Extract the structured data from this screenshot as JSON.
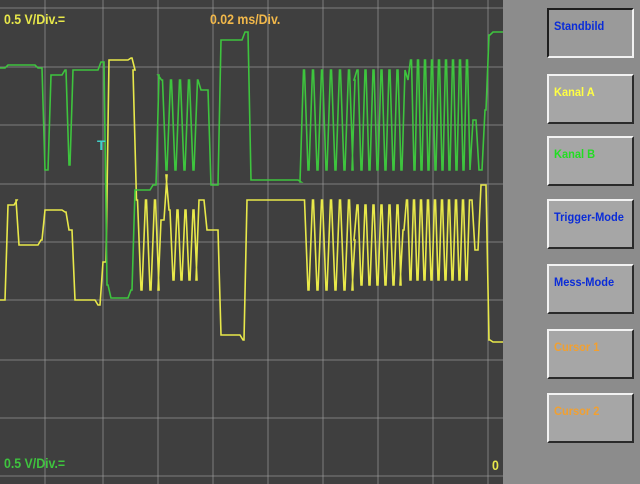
{
  "scope": {
    "ch_a_scale": "0.5 V/Div.=",
    "timebase": "0.02 ms/Div.",
    "ch_b_scale": "0.5 V/Div.=",
    "zero_marker": "0",
    "trigger_marker": "T",
    "colors": {
      "background": "#3f3f3f",
      "grid": "#9a9a9a",
      "channel_a": "#e8e84a",
      "channel_b": "#3ec43e",
      "timebase_text": "#f2b84a",
      "trigger": "#40d0c8"
    }
  },
  "buttons": [
    {
      "id": "standbild",
      "label": "Standbild",
      "color": "#0a2cd8",
      "active": true
    },
    {
      "id": "kanal-a",
      "label": "Kanal A",
      "color": "#ffff44",
      "active": false
    },
    {
      "id": "kanal-b",
      "label": "Kanal B",
      "color": "#22dd22",
      "active": false
    },
    {
      "id": "trigger-mode",
      "label": "Trigger-Mode",
      "color": "#0a2cd8",
      "active": false
    },
    {
      "id": "mess-mode",
      "label": "Mess-Mode",
      "color": "#0a2cd8",
      "active": false
    },
    {
      "id": "cursor-1",
      "label": "Cursor 1",
      "color": "#f2a030",
      "active": false
    },
    {
      "id": "cursor-2",
      "label": "Cursor 2",
      "color": "#f2a030",
      "active": false
    }
  ]
}
